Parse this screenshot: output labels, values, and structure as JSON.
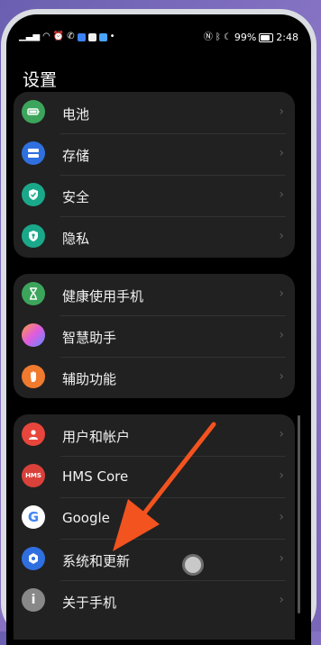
{
  "status_bar": {
    "battery": "99%",
    "time": "2:48",
    "left_icons": [
      "signal-icon",
      "wifi-icon",
      "alarm-icon",
      "call-icon",
      "app-icon",
      "app-icon",
      "app-icon",
      "more-icon"
    ],
    "right_icons": [
      "nfc-icon",
      "bluetooth-icon",
      "do-not-disturb-icon"
    ]
  },
  "page_title": "设置",
  "groups": [
    {
      "items": [
        {
          "label": "电池",
          "icon": "battery-icon",
          "color": "#3ca55c"
        },
        {
          "label": "存储",
          "icon": "storage-icon",
          "color": "#2f6fe0"
        },
        {
          "label": "安全",
          "icon": "security-icon",
          "color": "#1aa88a"
        },
        {
          "label": "隐私",
          "icon": "privacy-icon",
          "color": "#1aa88a"
        }
      ]
    },
    {
      "items": [
        {
          "label": "健康使用手机",
          "icon": "hourglass-icon",
          "color": "#3ca55c"
        },
        {
          "label": "智慧助手",
          "icon": "assistant-icon",
          "color": "#c46ef0"
        },
        {
          "label": "辅助功能",
          "icon": "hand-icon",
          "color": "#f07a2e"
        }
      ]
    },
    {
      "items": [
        {
          "label": "用户和帐户",
          "icon": "user-icon",
          "color": "#e8453c"
        },
        {
          "label": "HMS Core",
          "icon": "hms-icon",
          "color": "#d9413a",
          "badge": "HMS"
        },
        {
          "label": "Google",
          "icon": "google-icon",
          "color": "#ffffff",
          "badge": "G"
        },
        {
          "label": "系统和更新",
          "icon": "system-icon",
          "color": "#2f6fe0"
        },
        {
          "label": "关于手机",
          "icon": "info-icon",
          "color": "#888888",
          "badge": "i"
        }
      ]
    }
  ],
  "annotation": {
    "arrow_color": "#f2531f"
  }
}
